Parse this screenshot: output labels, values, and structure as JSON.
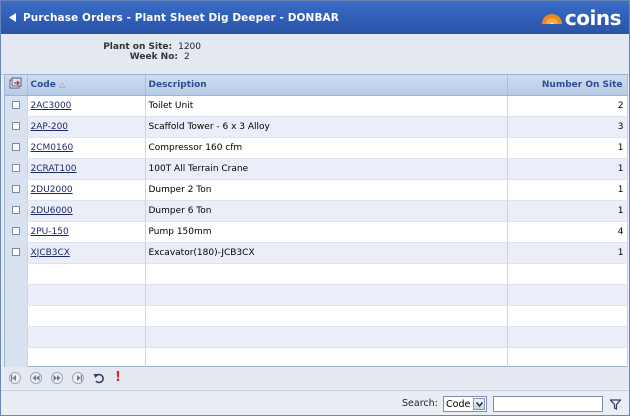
{
  "header": {
    "title": "Purchase Orders - Plant Sheet Dig Deeper - DONBAR",
    "logo_text": "coins",
    "colors": {
      "titlebar": "#2f5db5",
      "logo_mark": "#f08a1c"
    }
  },
  "info": {
    "plant_label": "Plant on Site:",
    "plant_value": "1200",
    "week_label": "Week No:",
    "week_value": "2"
  },
  "grid": {
    "columns": {
      "code": "Code",
      "description": "Description",
      "number": "Number On Site"
    },
    "rows": [
      {
        "code": "2AC3000",
        "description": "Toilet Unit",
        "number": "2"
      },
      {
        "code": "2AP-200",
        "description": "Scaffold Tower - 6 x 3 Alloy",
        "number": "3"
      },
      {
        "code": "2CM0160",
        "description": "Compressor 160 cfm",
        "number": "1"
      },
      {
        "code": "2CRAT100",
        "description": "100T All Terrain Crane",
        "number": "1"
      },
      {
        "code": "2DU2000",
        "description": "Dumper 2 Ton",
        "number": "1"
      },
      {
        "code": "2DU6000",
        "description": "Dumper 6 Ton",
        "number": "1"
      },
      {
        "code": "2PU-150",
        "description": "Pump 150mm",
        "number": "4"
      },
      {
        "code": "XJCB3CX",
        "description": "Excavator(180)-JCB3CX",
        "number": "1"
      }
    ]
  },
  "pager": {
    "icons": [
      "first-page-icon",
      "previous-page-icon",
      "next-page-icon",
      "last-page-icon",
      "refresh-icon",
      "alert-icon"
    ],
    "alert_glyph": "!"
  },
  "footer": {
    "search_label": "Search:",
    "search_field": "Code",
    "search_value": "",
    "filter_icon": "filter-icon"
  }
}
